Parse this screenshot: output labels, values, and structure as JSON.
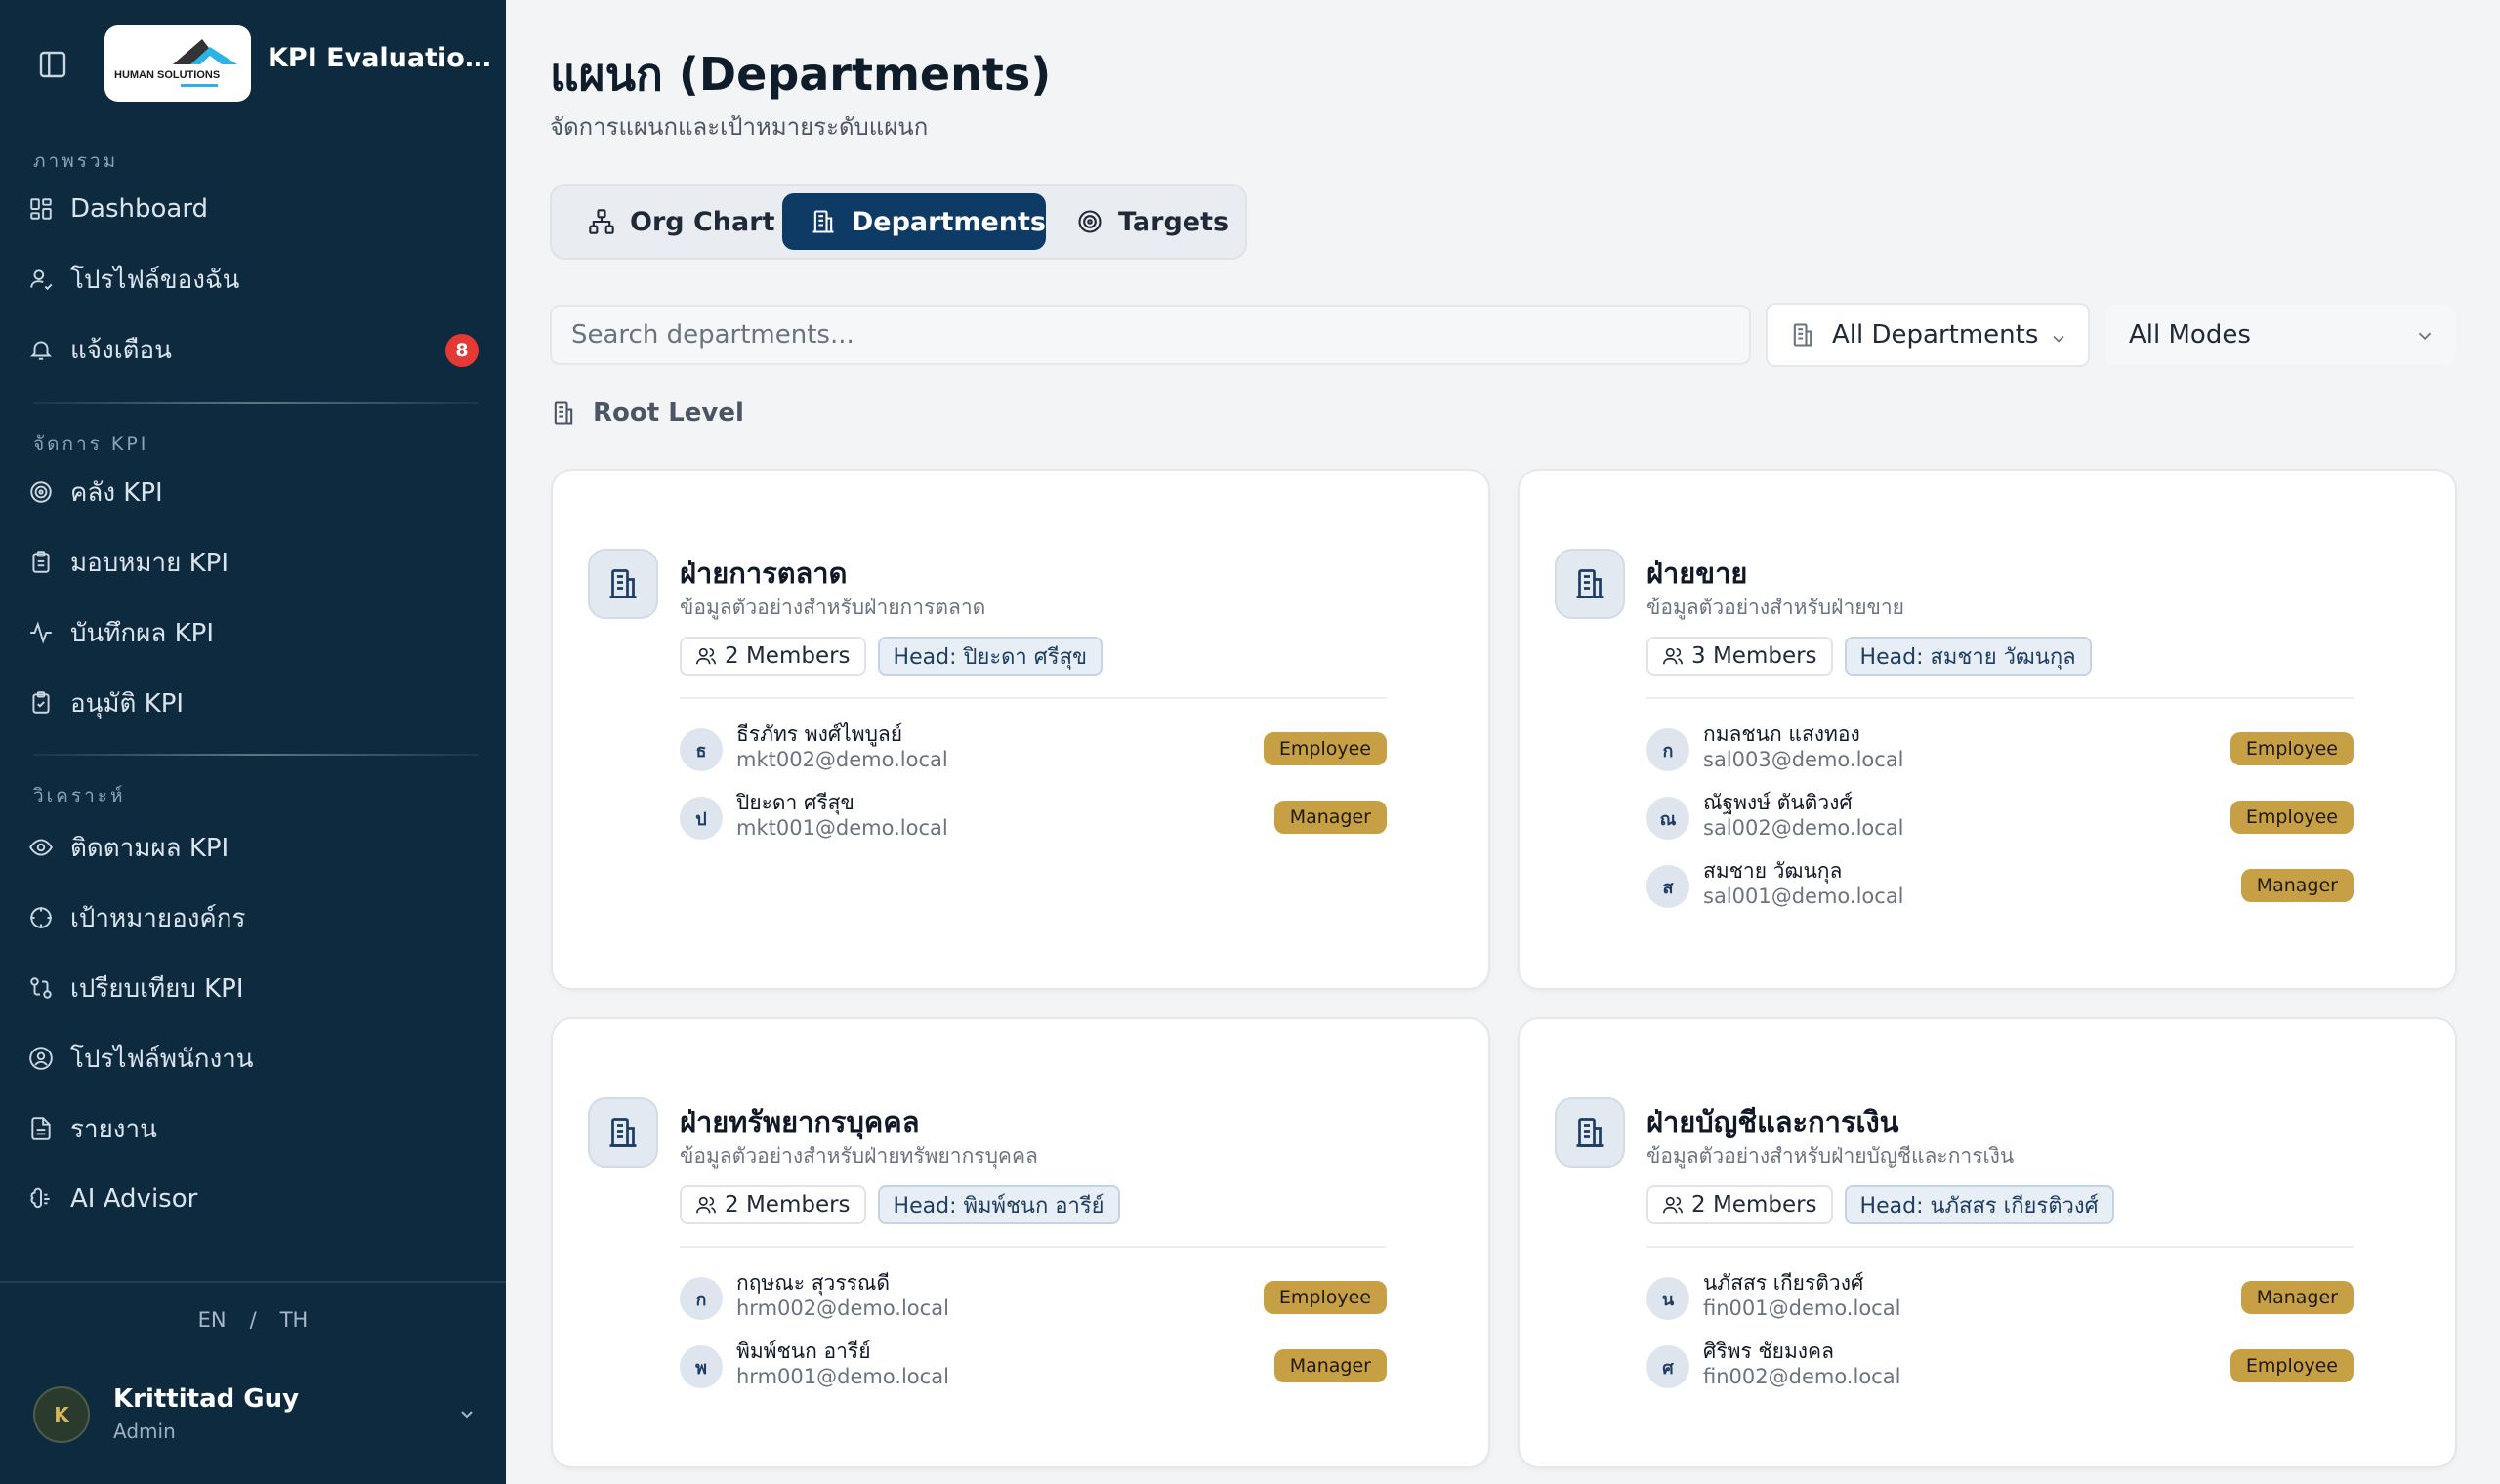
{
  "app": {
    "title": "KPI Evaluation ...",
    "logo_text": "HUMAN SOLUTIONS"
  },
  "sidebar": {
    "sections": [
      {
        "label": "ภาพรวม"
      },
      {
        "label": "จัดการ KPI"
      },
      {
        "label": "วิเคราะห์"
      }
    ],
    "items": [
      {
        "label": "Dashboard",
        "icon": "dashboard-grid-icon"
      },
      {
        "label": "โปรไฟล์ของฉัน",
        "icon": "user-icon"
      },
      {
        "label": "แจ้งเตือน",
        "icon": "bell-icon",
        "badge": "8"
      },
      {
        "label": "คลัง KPI",
        "icon": "target-icon"
      },
      {
        "label": "มอบหมาย KPI",
        "icon": "clipboard-icon"
      },
      {
        "label": "บันทึกผล KPI",
        "icon": "activity-icon"
      },
      {
        "label": "อนุมัติ KPI",
        "icon": "clipboard-check-icon"
      },
      {
        "label": "ติดตามผล KPI",
        "icon": "eye-icon"
      },
      {
        "label": "เป้าหมายองค์กร",
        "icon": "crosshair-icon"
      },
      {
        "label": "เปรียบเทียบ KPI",
        "icon": "compare-icon"
      },
      {
        "label": "โปรไฟล์พนักงาน",
        "icon": "user-circle-icon"
      },
      {
        "label": "รายงาน",
        "icon": "file-text-icon"
      },
      {
        "label": "AI Advisor",
        "icon": "brain-icon"
      }
    ],
    "lang": {
      "en": "EN",
      "sep": "/",
      "th": "TH"
    },
    "user": {
      "initial": "K",
      "name": "Krittitad Guy",
      "role": "Admin"
    }
  },
  "page": {
    "title": "แผนก (Departments)",
    "subtitle": "จัดการแผนกและเป้าหมายระดับแผนก"
  },
  "tabs": [
    {
      "label": "Org Chart",
      "icon": "org-chart-icon",
      "active": false
    },
    {
      "label": "Departments",
      "icon": "building-icon",
      "active": true
    },
    {
      "label": "Targets",
      "icon": "target-icon",
      "active": false
    }
  ],
  "filters": {
    "search_placeholder": "Search departments...",
    "department_select": "All Departments",
    "mode_select": "All Modes"
  },
  "root_level_label": "Root Level",
  "departments": [
    {
      "name": "ฝ่ายการตลาด",
      "description": "ข้อมูลตัวอย่างสำหรับฝ่ายการตลาด",
      "members_label": "2 Members",
      "head_label": "Head: ปิยะดา ศรีสุข",
      "members": [
        {
          "initial": "ธ",
          "name": "ธีรภัทร พงศ์ไพบูลย์",
          "email": "mkt002@demo.local",
          "role": "Employee"
        },
        {
          "initial": "ป",
          "name": "ปิยะดา ศรีสุข",
          "email": "mkt001@demo.local",
          "role": "Manager"
        }
      ]
    },
    {
      "name": "ฝ่ายขาย",
      "description": "ข้อมูลตัวอย่างสำหรับฝ่ายขาย",
      "members_label": "3 Members",
      "head_label": "Head: สมชาย วัฒนกุล",
      "members": [
        {
          "initial": "ก",
          "name": "กมลชนก แสงทอง",
          "email": "sal003@demo.local",
          "role": "Employee"
        },
        {
          "initial": "ณ",
          "name": "ณัฐพงษ์ ตันติวงศ์",
          "email": "sal002@demo.local",
          "role": "Employee"
        },
        {
          "initial": "ส",
          "name": "สมชาย วัฒนกุล",
          "email": "sal001@demo.local",
          "role": "Manager"
        }
      ]
    },
    {
      "name": "ฝ่ายทรัพยากรบุคคล",
      "description": "ข้อมูลตัวอย่างสำหรับฝ่ายทรัพยากรบุคคล",
      "members_label": "2 Members",
      "head_label": "Head: พิมพ์ชนก อารีย์",
      "members": [
        {
          "initial": "ก",
          "name": "กฤษณะ สุวรรณดี",
          "email": "hrm002@demo.local",
          "role": "Employee"
        },
        {
          "initial": "พ",
          "name": "พิมพ์ชนก อารีย์",
          "email": "hrm001@demo.local",
          "role": "Manager"
        }
      ]
    },
    {
      "name": "ฝ่ายบัญชีและการเงิน",
      "description": "ข้อมูลตัวอย่างสำหรับฝ่ายบัญชีและการเงิน",
      "members_label": "2 Members",
      "head_label": "Head: นภัสสร เกียรติวงศ์",
      "members": [
        {
          "initial": "น",
          "name": "นภัสสร เกียรติวงศ์",
          "email": "fin001@demo.local",
          "role": "Manager"
        },
        {
          "initial": "ศ",
          "name": "ศิริพร ชัยมงคล",
          "email": "fin002@demo.local",
          "role": "Employee"
        }
      ]
    }
  ]
}
